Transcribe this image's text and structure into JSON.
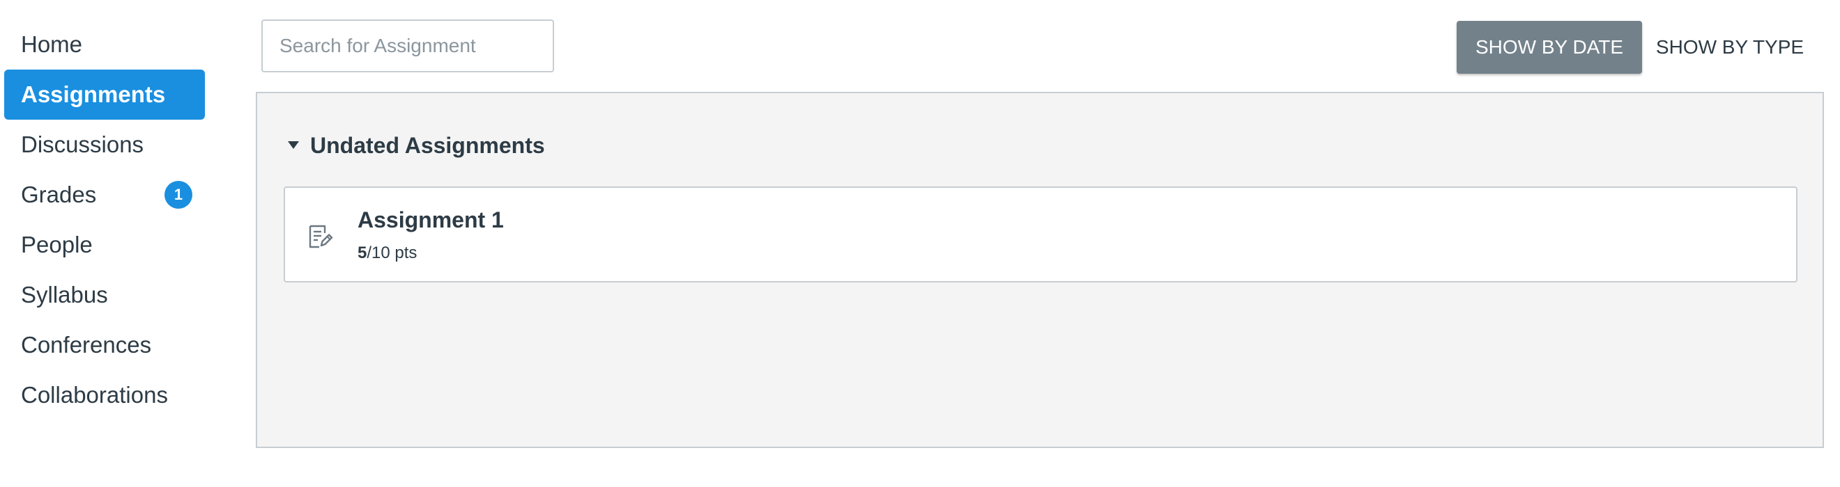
{
  "sidebar": {
    "items": [
      {
        "label": "Home"
      },
      {
        "label": "Assignments"
      },
      {
        "label": "Discussions"
      },
      {
        "label": "Grades",
        "badge": "1"
      },
      {
        "label": "People"
      },
      {
        "label": "Syllabus"
      },
      {
        "label": "Conferences"
      },
      {
        "label": "Collaborations"
      }
    ],
    "active_item": "Assignments"
  },
  "toolbar": {
    "search_placeholder": "Search for Assignment",
    "search_value": "",
    "show_by_date_label": "SHOW BY DATE",
    "show_by_type_label": "SHOW BY TYPE"
  },
  "main": {
    "group_title": "Undated Assignments",
    "assignments": [
      {
        "title": "Assignment 1",
        "score": "5",
        "points": "/10 pts",
        "icon": "assignment-icon"
      }
    ]
  },
  "colors": {
    "accent": "#1a8fe0",
    "active_button": "#73818b",
    "text": "#2d3b45",
    "panel_bg": "#f4f4f4",
    "border": "#c7cdd1"
  }
}
